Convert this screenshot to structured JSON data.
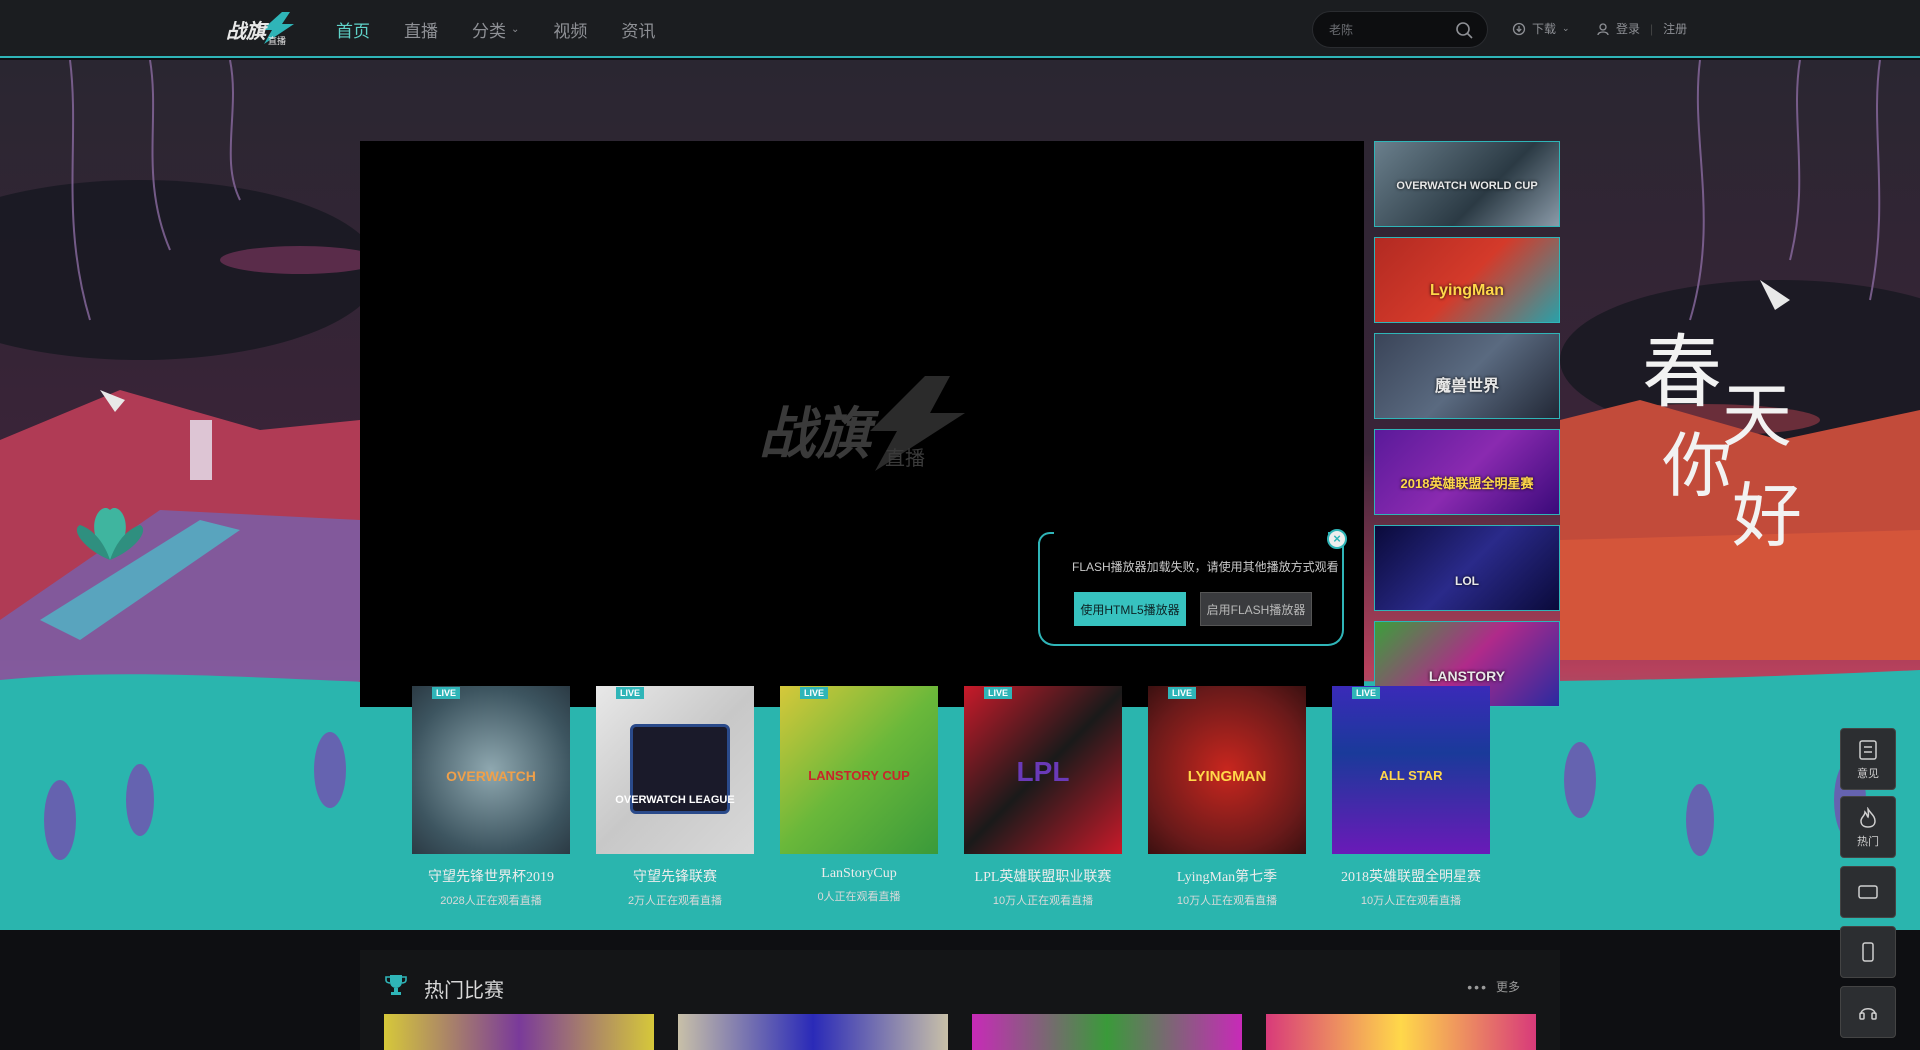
{
  "header": {
    "nav": [
      {
        "label": "首页",
        "active": true
      },
      {
        "label": "直播"
      },
      {
        "label": "分类"
      },
      {
        "label": "视频"
      },
      {
        "label": "资讯"
      }
    ],
    "search_placeholder": "老陈",
    "download_label": "下载",
    "login_label": "登录",
    "register_label": "注册"
  },
  "player": {
    "logo_text": "战旗",
    "logo_sub": "直播",
    "flash_message": "FLASH播放器加载失败，请使用其他播放方式观看",
    "html5_button": "使用HTML5播放器",
    "flash_button": "启用FLASH播放器"
  },
  "side_thumbs": [
    {
      "label": "OVERWATCH WORLD CUP"
    },
    {
      "label": "LyingMan"
    },
    {
      "label": "魔兽世界"
    },
    {
      "label": "2018英雄联盟全明星赛"
    },
    {
      "label": "LOL"
    },
    {
      "label": "LANSTORY"
    }
  ],
  "spring_text": [
    "春",
    "天",
    "你",
    "好"
  ],
  "live_cards": [
    {
      "title": "守望先锋世界杯2019",
      "viewers": "2028人正在观看直播",
      "badge": "LIVE",
      "logo": "OVERWATCH",
      "color": "#6f8f9c"
    },
    {
      "title": "守望先锋联赛",
      "viewers": "2万人正在观看直播",
      "badge": "LIVE",
      "logo": "OVERWATCH LEAGUE",
      "color": "#d8d8d8"
    },
    {
      "title": "LanStoryCup",
      "viewers": "0人正在观看直播",
      "badge": "LIVE",
      "logo": "LANSTORY CUP",
      "color": "#5fb94a"
    },
    {
      "title": "LPL英雄联盟职业联赛",
      "viewers": "10万人正在观看直播",
      "badge": "LIVE",
      "logo": "LPL",
      "color": "#b01d2f"
    },
    {
      "title": "LyingMan第七季",
      "viewers": "10万人正在观看直播",
      "badge": "LIVE",
      "logo": "LYINGMAN",
      "color": "#c4261e"
    },
    {
      "title": "2018英雄联盟全明星赛",
      "viewers": "10万人正在观看直播",
      "badge": "LIVE",
      "logo": "ALL STAR",
      "color": "#3b1a9a"
    }
  ],
  "float_menu": [
    {
      "label": "意见",
      "icon": "feedback-icon"
    },
    {
      "label": "热门",
      "icon": "fire-icon"
    },
    {
      "label": "",
      "icon": "video-icon"
    },
    {
      "label": "",
      "icon": "phone-icon"
    },
    {
      "label": "",
      "icon": "headset-icon"
    }
  ],
  "hot_section": {
    "title": "热门比赛",
    "more_label": "更多"
  },
  "colors": {
    "accent": "#2fb5b8",
    "nav_active": "#5fd3c9",
    "topbar_bg": "#1b1d20"
  }
}
